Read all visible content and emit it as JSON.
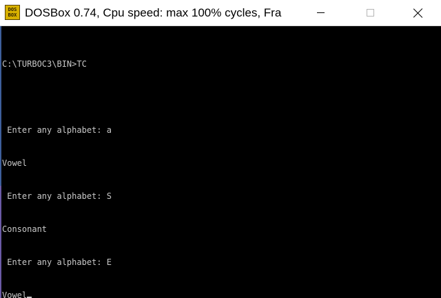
{
  "window": {
    "title": "DOSBox 0.74, Cpu speed: max 100% cycles, Fra",
    "icon": {
      "name": "dosbox-icon",
      "line1": "DOS",
      "line2": "BOX"
    }
  },
  "controls": {
    "minimize": "minimize-icon",
    "maximize": "maximize-icon",
    "close": "close-icon"
  },
  "console": {
    "lines": [
      "C:\\TURBOC3\\BIN>TC",
      "",
      " Enter any alphabet: a",
      "Vowel",
      " Enter any alphabet: S",
      "Consonant",
      " Enter any alphabet: E",
      "Vowel"
    ],
    "text_color": "#c8c8c8",
    "background": "#000000"
  }
}
